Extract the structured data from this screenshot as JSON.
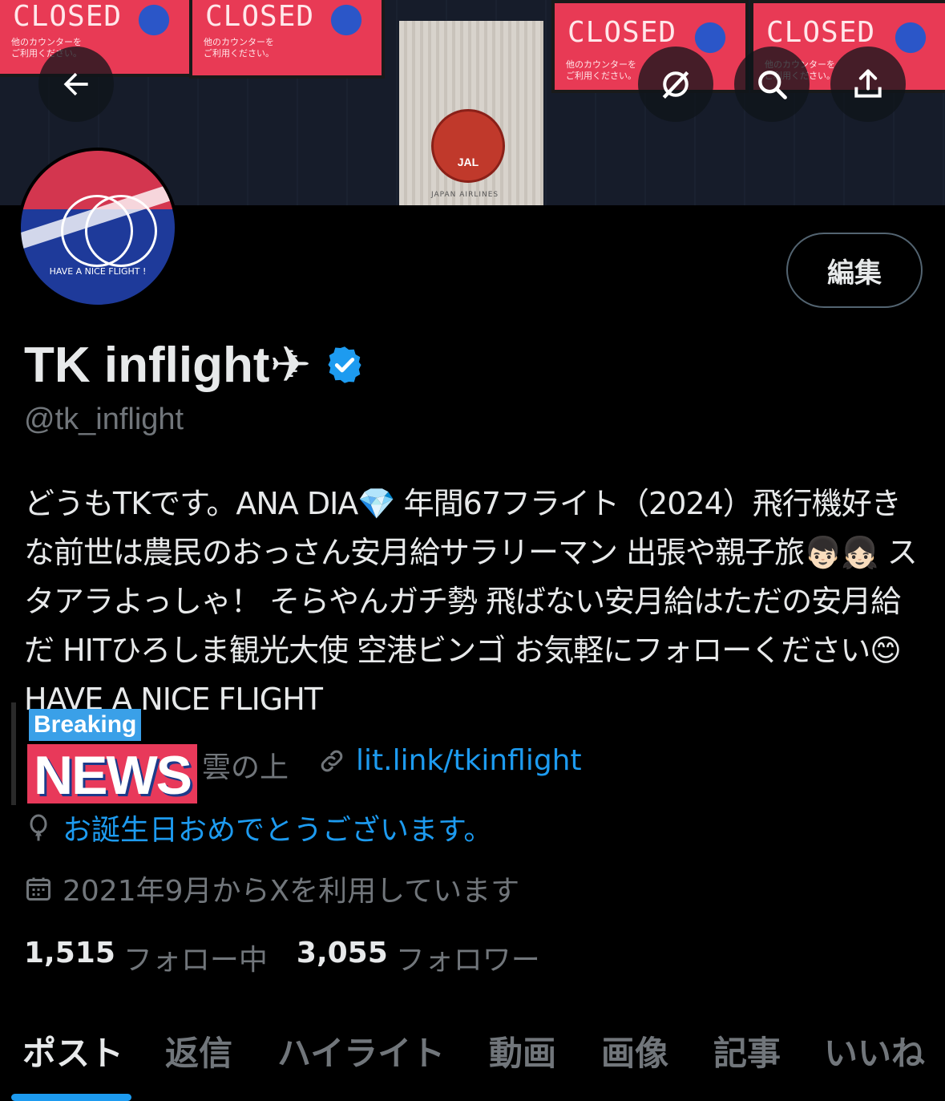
{
  "banner": {
    "signs": [
      {
        "closed": "CLOSED",
        "sub": "他のカウンターを\nご利用ください。"
      },
      {
        "closed": "CLOSED",
        "sub": "他のカウンターを\nご利用ください。"
      },
      {
        "closed": "CLOSED",
        "sub": "他のカウンターを\nご利用ください。"
      },
      {
        "closed": "CLOSED",
        "sub": "他のカウンターを\nご利用ください。"
      }
    ],
    "logo_text": "JAL",
    "logo_sub": "JAPAN AIRLINES"
  },
  "nav": {
    "back_icon": "arrow-left-icon",
    "grok_icon": "grok-icon",
    "search_icon": "search-icon",
    "share_icon": "share-icon"
  },
  "avatar": {
    "text": "HAVE A NICE FLIGHT !"
  },
  "profile": {
    "edit_label": "編集",
    "name": "TK inflight✈︎",
    "handle": "@tk_inflight",
    "bio": "どうもTKです。ANA DIA💎 年間67フライト（2024）飛行機好きな前世は農民のおっさん安月給サラリーマン 出張や親子旅👦🏻👧🏻 スタアラよっしゃ！ そらやんガチ勢 飛ばない安月給はただの安月給だ HITひろしま観光大使 空港ビンゴ お気軽にフォローください😊 HAVE A NICE FLIGHT",
    "location": "雲の上",
    "link": "lit.link/tkinflight",
    "birthday": "お誕生日おめでとうございます。",
    "joined": "2021年9月からXを利用しています"
  },
  "overlay": {
    "line1": "Breaking",
    "line2": "NEWS"
  },
  "stats": {
    "following_count": "1,515",
    "following_label": "フォロー中",
    "followers_count": "3,055",
    "followers_label": "フォロワー"
  },
  "tabs": [
    "ポスト",
    "返信",
    "ハイライト",
    "動画",
    "画像",
    "記事",
    "いいね"
  ],
  "colors": {
    "accent": "#1d9bf0",
    "muted": "#71767b",
    "background": "#000000"
  }
}
